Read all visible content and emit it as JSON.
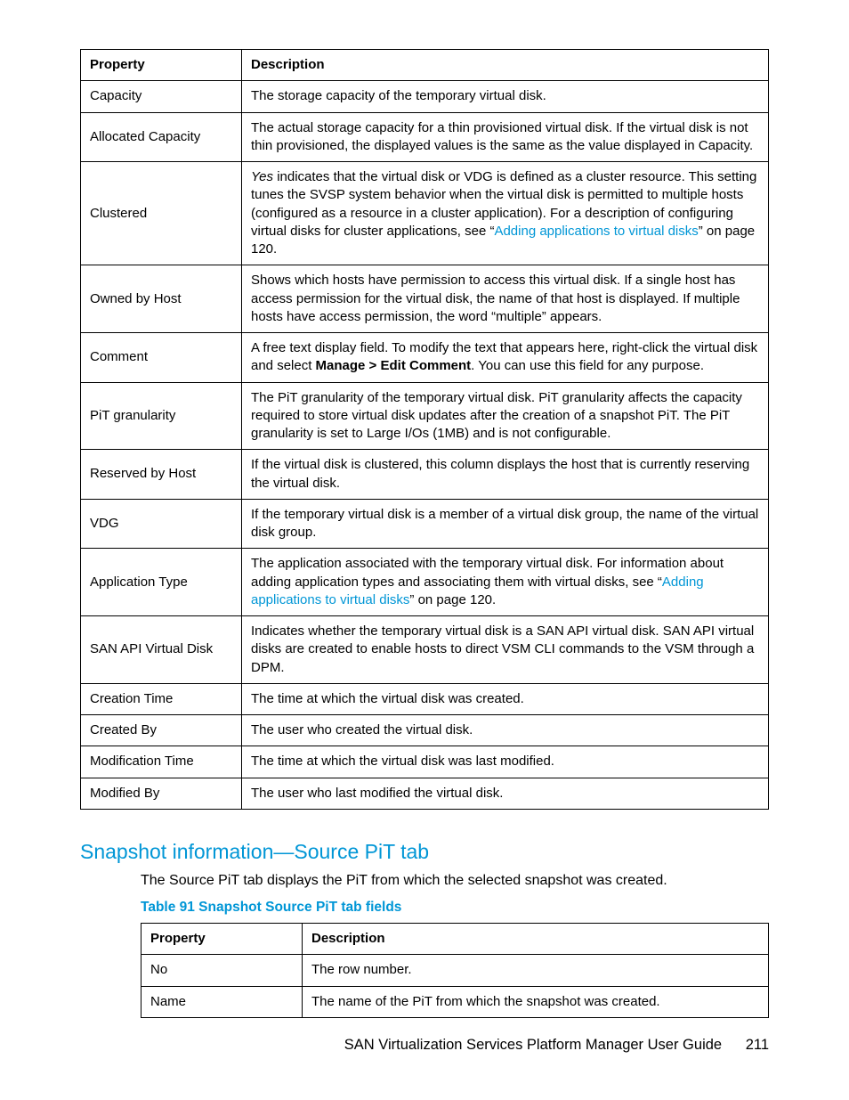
{
  "table1": {
    "headers": {
      "prop": "Property",
      "desc": "Description"
    },
    "rows": [
      {
        "prop": "Capacity",
        "desc_plain": "The storage capacity of the temporary virtual disk."
      },
      {
        "prop": "Allocated Capacity",
        "desc_plain": "The actual storage capacity for a thin provisioned virtual disk. If the virtual disk is not thin provisioned, the displayed values is the same as the value displayed in Capacity."
      },
      {
        "prop": "Clustered",
        "parts": {
          "lead_italic": "Yes",
          "mid": " indicates that the virtual disk or VDG is defined as a cluster resource. This setting tunes the SVSP system behavior when the virtual disk is permitted to multiple hosts (configured as a resource in a cluster application). For a description of configuring virtual disks for cluster applications, see “",
          "link": "Adding applications to virtual disks",
          "tail": "” on page 120."
        }
      },
      {
        "prop": "Owned by Host",
        "desc_plain": "Shows which hosts have permission to access this virtual disk. If a single host has access permission for the virtual disk, the name of that host is displayed. If multiple hosts have access permission, the word “multiple” appears."
      },
      {
        "prop": "Comment",
        "comment_parts": {
          "pre": "A free text display field. To modify the text that appears here, right-click the virtual disk and select ",
          "bold": "Manage > Edit Comment",
          "post": ". You can use this field for any purpose."
        }
      },
      {
        "prop": "PiT granularity",
        "desc_plain": "The PiT granularity of the temporary virtual disk. PiT granularity affects the capacity required to store virtual disk updates after the creation of a snapshot PiT. The PiT granularity is set to Large I/Os (1MB) and is not configurable."
      },
      {
        "prop": "Reserved by Host",
        "desc_plain": "If the virtual disk is clustered, this column displays the host that is currently reserving the virtual disk."
      },
      {
        "prop": "VDG",
        "desc_plain": "If the temporary virtual disk is a member of a virtual disk group, the name of the virtual disk group."
      },
      {
        "prop": "Application Type",
        "app_parts": {
          "pre": "The application associated with the temporary virtual disk. For information about adding application types and associating them with virtual disks, see “",
          "link": "Adding applications to virtual disks",
          "post": "” on page 120."
        }
      },
      {
        "prop": "SAN API Virtual Disk",
        "desc_plain": "Indicates whether the temporary virtual disk is a SAN API virtual disk. SAN API virtual disks are created to enable hosts to direct VSM CLI commands to the VSM through a DPM."
      },
      {
        "prop": "Creation Time",
        "desc_plain": "The time at which the virtual disk was created."
      },
      {
        "prop": "Created By",
        "desc_plain": "The user who created the virtual disk."
      },
      {
        "prop": "Modification Time",
        "desc_plain": "The time at which the virtual disk was last modified."
      },
      {
        "prop": "Modified By",
        "desc_plain": "The user who last modified the virtual disk."
      }
    ]
  },
  "section": {
    "heading": "Snapshot information—Source PiT tab",
    "para": "The Source PiT tab displays the PiT from which the selected snapshot was created.",
    "table_caption": "Table 91 Snapshot Source PiT tab fields"
  },
  "table2": {
    "headers": {
      "prop": "Property",
      "desc": "Description"
    },
    "rows": [
      {
        "prop": "No",
        "desc": "The row number."
      },
      {
        "prop": "Name",
        "desc": "The name of the PiT from which the snapshot was created."
      }
    ]
  },
  "footer": {
    "title": "SAN Virtualization Services Platform Manager User Guide",
    "page": "211"
  }
}
